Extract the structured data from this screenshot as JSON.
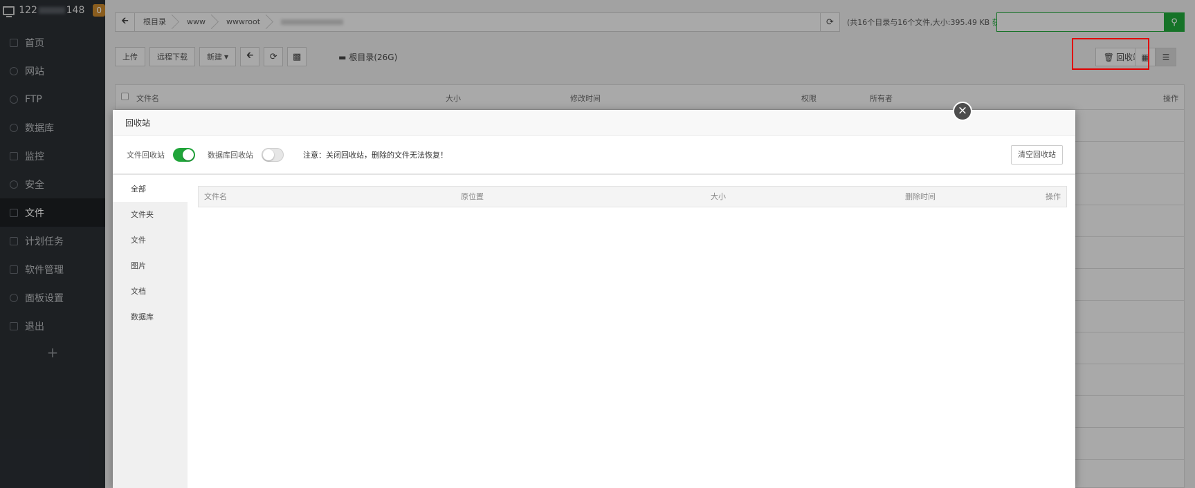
{
  "sidebar": {
    "host_prefix": "122",
    "host_suffix": "148",
    "badge": "0",
    "items": [
      {
        "label": "首页",
        "icon": "home-icon"
      },
      {
        "label": "网站",
        "icon": "globe-icon"
      },
      {
        "label": "FTP",
        "icon": "ftp-icon"
      },
      {
        "label": "数据库",
        "icon": "database-icon"
      },
      {
        "label": "监控",
        "icon": "monitor-icon"
      },
      {
        "label": "安全",
        "icon": "shield-icon"
      },
      {
        "label": "文件",
        "icon": "folder-icon"
      },
      {
        "label": "计划任务",
        "icon": "calendar-icon"
      },
      {
        "label": "软件管理",
        "icon": "grid-icon"
      },
      {
        "label": "面板设置",
        "icon": "gear-icon"
      },
      {
        "label": "退出",
        "icon": "logout-icon"
      }
    ],
    "add_label": "+"
  },
  "path": {
    "segments": [
      "根目录",
      "www",
      "wwwroot"
    ],
    "summary": "(共16个目录与16个文件,大小:395.49 KB",
    "get_link": "获取)"
  },
  "toolbar": {
    "upload": "上传",
    "remote_download": "远程下载",
    "new": "新建",
    "disk": "根目录(26G)",
    "recycle_bin": "回收站"
  },
  "file_table": {
    "headers": {
      "name": "文件名",
      "size": "大小",
      "mtime": "修改时间",
      "perm": "权限",
      "owner": "所有者",
      "ops": "操作"
    }
  },
  "modal": {
    "title": "回收站",
    "file_recycle_label": "文件回收站",
    "file_recycle_on": true,
    "db_recycle_label": "数据库回收站",
    "db_recycle_on": false,
    "note": "注意：关闭回收站，删除的文件无法恢复！",
    "clear_button": "清空回收站",
    "categories": [
      "全部",
      "文件夹",
      "文件",
      "图片",
      "文档",
      "数据库"
    ],
    "active_category": "全部",
    "columns": {
      "name": "文件名",
      "origin": "原位置",
      "size": "大小",
      "deleted": "删除时间",
      "ops": "操作"
    }
  },
  "colors": {
    "accent": "#20a53a",
    "highlight": "#e00000",
    "sidebar_bg": "#2a2e33"
  }
}
